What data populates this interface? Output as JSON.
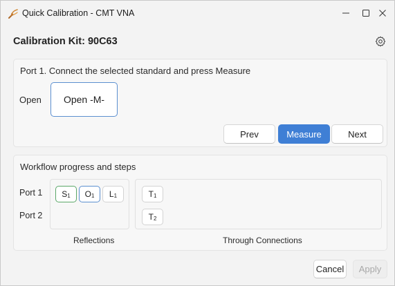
{
  "window": {
    "title": "Quick Calibration - CMT VNA",
    "icon": "vna-probe-icon",
    "controls": [
      "minimize-icon",
      "maximize-icon",
      "close-icon"
    ]
  },
  "header": {
    "kit_title": "Calibration Kit: 90C63",
    "settings_icon": "gear-icon"
  },
  "measure_panel": {
    "instruction": "Port 1. Connect the selected standard and press Measure",
    "standard_label": "Open",
    "standard_card": "Open -M-",
    "buttons": {
      "prev": "Prev",
      "measure": "Measure",
      "next": "Next"
    }
  },
  "workflow_panel": {
    "heading": "Workflow progress and steps",
    "ports": [
      "Port 1",
      "Port 2"
    ],
    "reflections": [
      {
        "letter": "S",
        "sub": "1",
        "state": "done"
      },
      {
        "letter": "O",
        "sub": "1",
        "state": "current"
      },
      {
        "letter": "L",
        "sub": "1",
        "state": "pending"
      }
    ],
    "throughs": [
      {
        "letter": "T",
        "sub": "1"
      },
      {
        "letter": "T",
        "sub": "2"
      }
    ],
    "captions": {
      "reflections": "Reflections",
      "through": "Through Connections"
    }
  },
  "footer": {
    "cancel": "Cancel",
    "apply": "Apply"
  },
  "colors": {
    "accent": "#3f7fd5",
    "done": "#5aa768",
    "current": "#5b8fd0"
  }
}
